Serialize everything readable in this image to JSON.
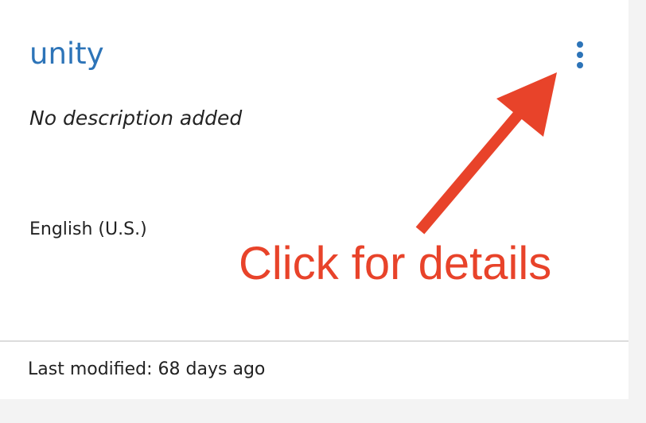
{
  "card": {
    "title": "unity",
    "description": "No description added",
    "language": "English (U.S.)",
    "last_modified": "Last modified: 68 days ago",
    "accent_color": "#2d74b8",
    "menu_icon": "kebab-vertical-icon"
  },
  "annotation": {
    "text": "Click for details",
    "color": "#e8432a",
    "arrow_icon": "arrow-up-right-icon"
  }
}
